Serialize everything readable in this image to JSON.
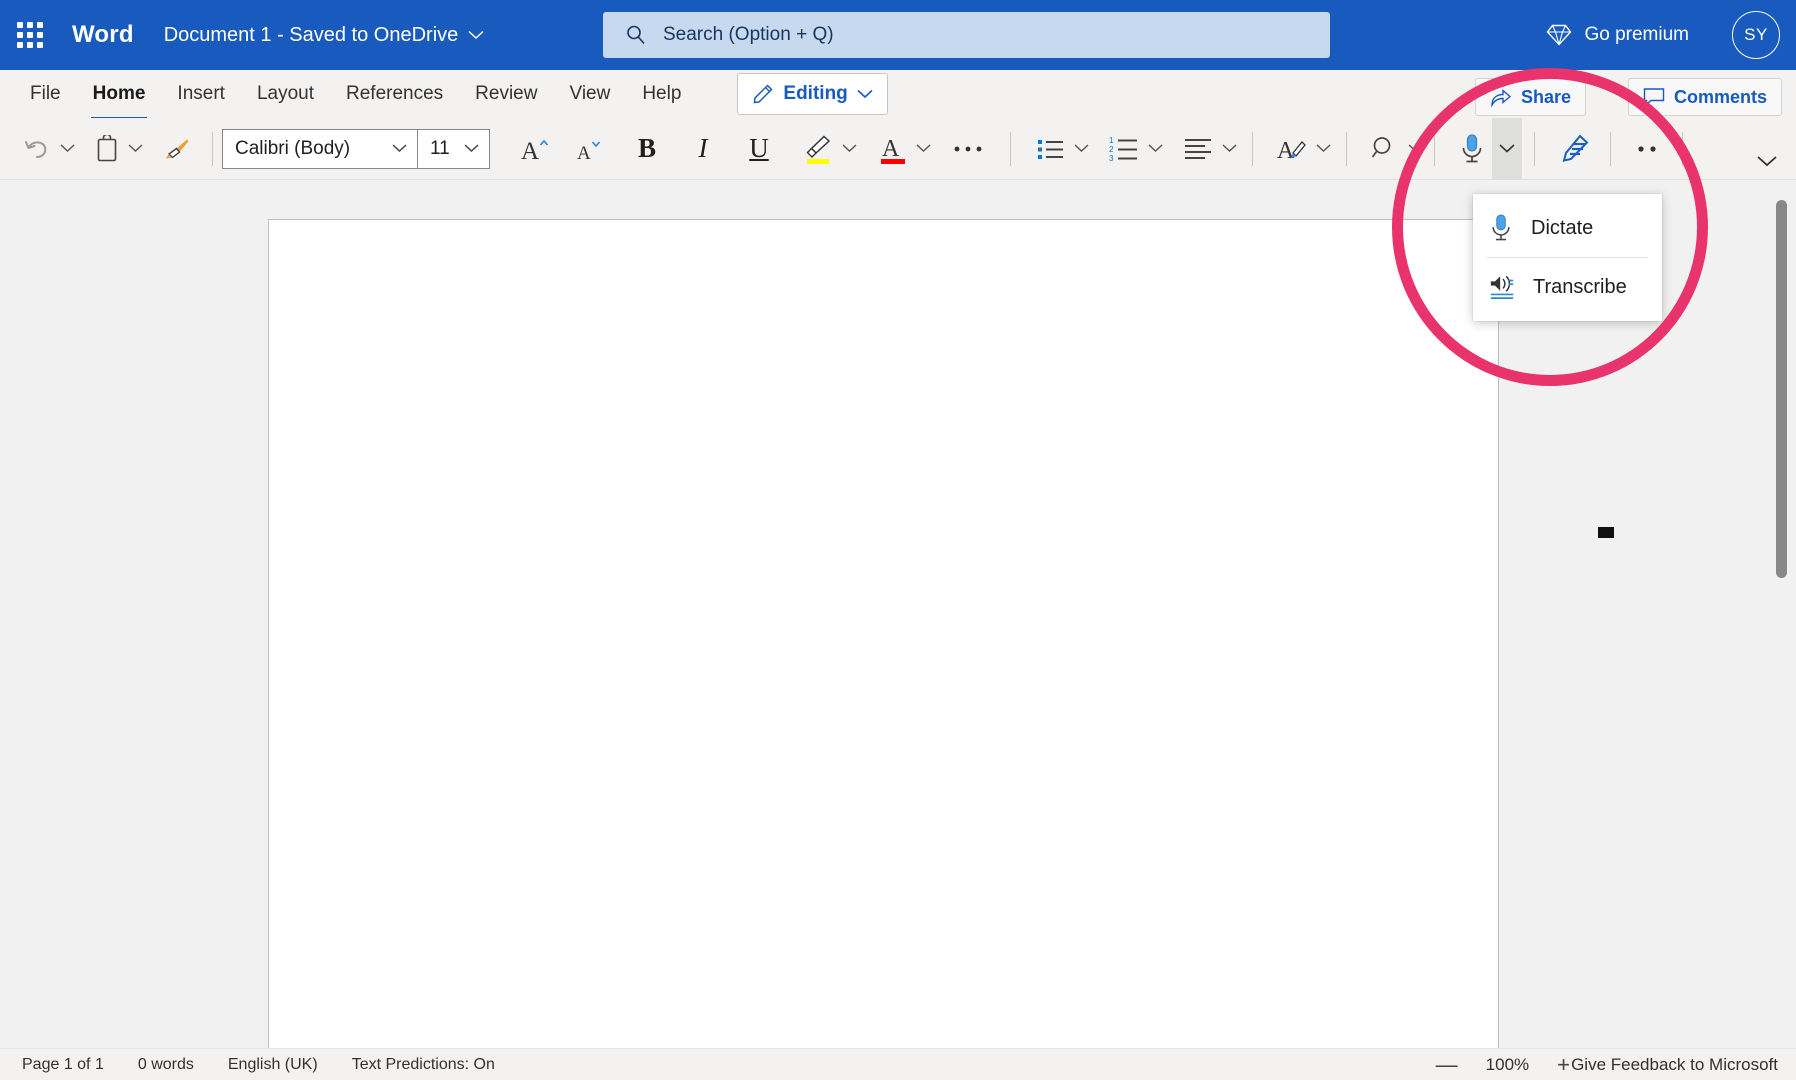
{
  "titlebar": {
    "waffle_name": "app-launcher",
    "app_name": "Word",
    "doc_title": "Document 1  -  Saved to OneDrive",
    "go_premium": "Go premium",
    "avatar_initials": "SY",
    "brand_color": "#185ABD"
  },
  "search": {
    "placeholder": "Search (Option + Q)",
    "value": ""
  },
  "ribbon": {
    "tabs": [
      {
        "label": "File",
        "active": false
      },
      {
        "label": "Home",
        "active": true
      },
      {
        "label": "Insert",
        "active": false
      },
      {
        "label": "Layout",
        "active": false
      },
      {
        "label": "References",
        "active": false
      },
      {
        "label": "Review",
        "active": false
      },
      {
        "label": "View",
        "active": false
      },
      {
        "label": "Help",
        "active": false
      }
    ],
    "editing_label": "Editing",
    "share_label": "Share",
    "comments_label": "Comments",
    "accent_color": "#185ABD",
    "active_tab_underline": "#2b579a"
  },
  "toolbar": {
    "undo": "Undo",
    "paste": "Paste",
    "format_painter": "Format Painter",
    "font_name": "Calibri (Body)",
    "font_size": "11",
    "grow_font": "Grow font",
    "shrink_font": "Shrink font",
    "bold": "B",
    "italic": "I",
    "underline": "U",
    "highlight": "Text Highlight Color",
    "highlight_color": "#FFFF00",
    "font_color": "Font Color",
    "font_color_value": "#FF0000",
    "more_font": "More font options",
    "bullets": "Bullets",
    "numbering": "Numbering",
    "alignment": "Alignment",
    "styles": "Styles",
    "find": "Find",
    "dictate": "Dictate",
    "editor": "Editor",
    "more_options": "More options",
    "collapse_ribbon": "Collapse ribbon"
  },
  "dictate_menu": {
    "items": [
      {
        "label": "Dictate",
        "icon": "microphone-icon"
      },
      {
        "label": "Transcribe",
        "icon": "speaker-waves-icon"
      }
    ]
  },
  "annotation": {
    "shape": "circle",
    "color": "#e8336d",
    "stroke_px": 11
  },
  "document": {
    "page_background": "#ffffff",
    "canvas_background": "#f1f1f1",
    "content": ""
  },
  "statusbar": {
    "page": "Page 1 of 1",
    "words": "0 words",
    "language": "English (UK)",
    "predictions": "Text Predictions: On",
    "zoom_out": "—",
    "zoom_value": "100%",
    "zoom_in": "+",
    "feedback": "Give Feedback to Microsoft"
  }
}
